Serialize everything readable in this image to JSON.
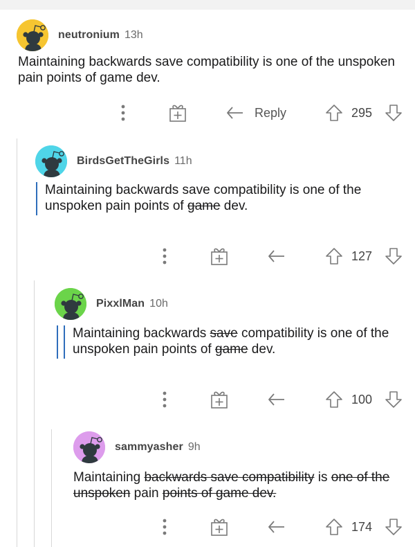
{
  "comments": [
    {
      "author": "neutronium",
      "age": "13h",
      "avatar_color": "#f6c531",
      "text_parts": [
        {
          "t": "Maintaining backwards save compatibility is one of the unspoken pain points of game dev.",
          "s": false
        }
      ],
      "reply_label": "Reply",
      "score": "295",
      "quote_depth": 0
    },
    {
      "author": "BirdsGetTheGirls",
      "age": "11h",
      "avatar_color": "#4fd5e8",
      "text_parts": [
        {
          "t": "Maintaining backwards save compatibility is one of the unspoken pain points of ",
          "s": false
        },
        {
          "t": "game",
          "s": true
        },
        {
          "t": " dev.",
          "s": false
        }
      ],
      "score": "127",
      "quote_depth": 1
    },
    {
      "author": "PixxlMan",
      "age": "10h",
      "avatar_color": "#6bd44a",
      "text_parts": [
        {
          "t": "Maintaining backwards ",
          "s": false
        },
        {
          "t": "save",
          "s": true
        },
        {
          "t": " compatibility is one of the unspoken pain points of ",
          "s": false
        },
        {
          "t": "game",
          "s": true
        },
        {
          "t": " dev.",
          "s": false
        }
      ],
      "score": "100",
      "quote_depth": 2
    },
    {
      "author": "sammyasher",
      "age": "9h",
      "avatar_color": "#dd9cec",
      "text_parts": [
        {
          "t": "Maintaining ",
          "s": false
        },
        {
          "t": "backwards save compatibility",
          "s": true
        },
        {
          "t": " is ",
          "s": false
        },
        {
          "t": "one of the unspoken",
          "s": true
        },
        {
          "t": " pain ",
          "s": false
        },
        {
          "t": "points of game dev.",
          "s": true
        }
      ],
      "score": "174",
      "quote_depth": 0
    }
  ],
  "colors": {
    "quote_bar": "#2e6dbb",
    "thread_line": "#d7d7d7",
    "icon": "#7a7a7a"
  },
  "icons": [
    "more-options-icon",
    "award-icon",
    "reply-icon",
    "upvote-icon",
    "downvote-icon",
    "snoo-avatar-icon"
  ]
}
